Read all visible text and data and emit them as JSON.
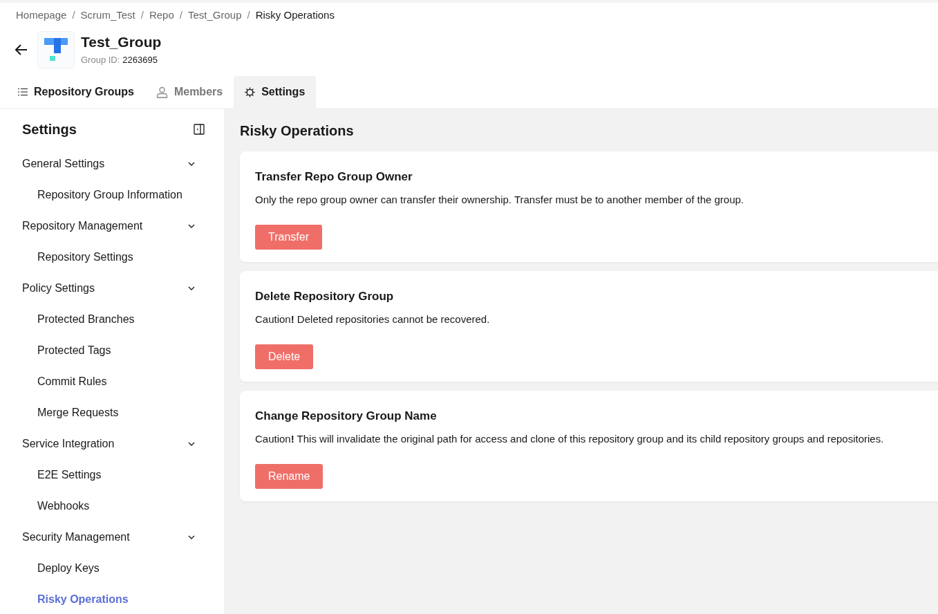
{
  "breadcrumb": [
    {
      "kind": "link",
      "label": "Homepage"
    },
    {
      "kind": "separator",
      "label": "/"
    },
    {
      "kind": "link",
      "label": "Scrum_Test"
    },
    {
      "kind": "separator",
      "label": "/"
    },
    {
      "kind": "link",
      "label": "Repo"
    },
    {
      "kind": "separator",
      "label": "/"
    },
    {
      "kind": "link",
      "label": "Test_Group"
    },
    {
      "kind": "separator",
      "label": "/"
    },
    {
      "kind": "current",
      "label": "Risky Operations"
    }
  ],
  "header": {
    "title": "Test_Group",
    "id_label": "Group ID:",
    "id_value": "2263695"
  },
  "tabs": [
    {
      "label": "Repository Groups",
      "selected": false,
      "muted": false
    },
    {
      "label": "Members",
      "selected": false,
      "muted": true
    },
    {
      "label": "Settings",
      "selected": true,
      "muted": false
    }
  ],
  "sidebar": {
    "title": "Settings",
    "groups": [
      {
        "label": "General Settings",
        "expanded": true,
        "children": [
          {
            "label": "Repository Group Information",
            "selected": false
          }
        ]
      },
      {
        "label": "Repository Management",
        "expanded": true,
        "children": [
          {
            "label": "Repository Settings",
            "selected": false
          }
        ]
      },
      {
        "label": "Policy Settings",
        "expanded": true,
        "children": [
          {
            "label": "Protected Branches",
            "selected": false
          },
          {
            "label": "Protected Tags",
            "selected": false
          },
          {
            "label": "Commit Rules",
            "selected": false
          },
          {
            "label": "Merge Requests",
            "selected": false
          }
        ]
      },
      {
        "label": "Service Integration",
        "expanded": true,
        "children": [
          {
            "label": "E2E Settings",
            "selected": false
          },
          {
            "label": "Webhooks",
            "selected": false
          }
        ]
      },
      {
        "label": "Security Management",
        "expanded": true,
        "children": [
          {
            "label": "Deploy Keys",
            "selected": false
          },
          {
            "label": "Risky Operations",
            "selected": true
          }
        ]
      }
    ]
  },
  "main": {
    "title": "Risky Operations",
    "cards": [
      {
        "title": "Transfer Repo Group Owner",
        "description": "Only the repo group owner can transfer their ownership. Transfer must be to another member of the group.",
        "button": "Transfer"
      },
      {
        "title": "Delete Repository Group",
        "description": "Caution**!** Deleted repositories cannot be recovered.",
        "button": "Delete"
      },
      {
        "title": "Change Repository Group Name",
        "description": "Caution**!** This will invalidate the original path for access and clone of this repository group and its child repository groups and repositories.",
        "button": "Rename"
      }
    ]
  }
}
